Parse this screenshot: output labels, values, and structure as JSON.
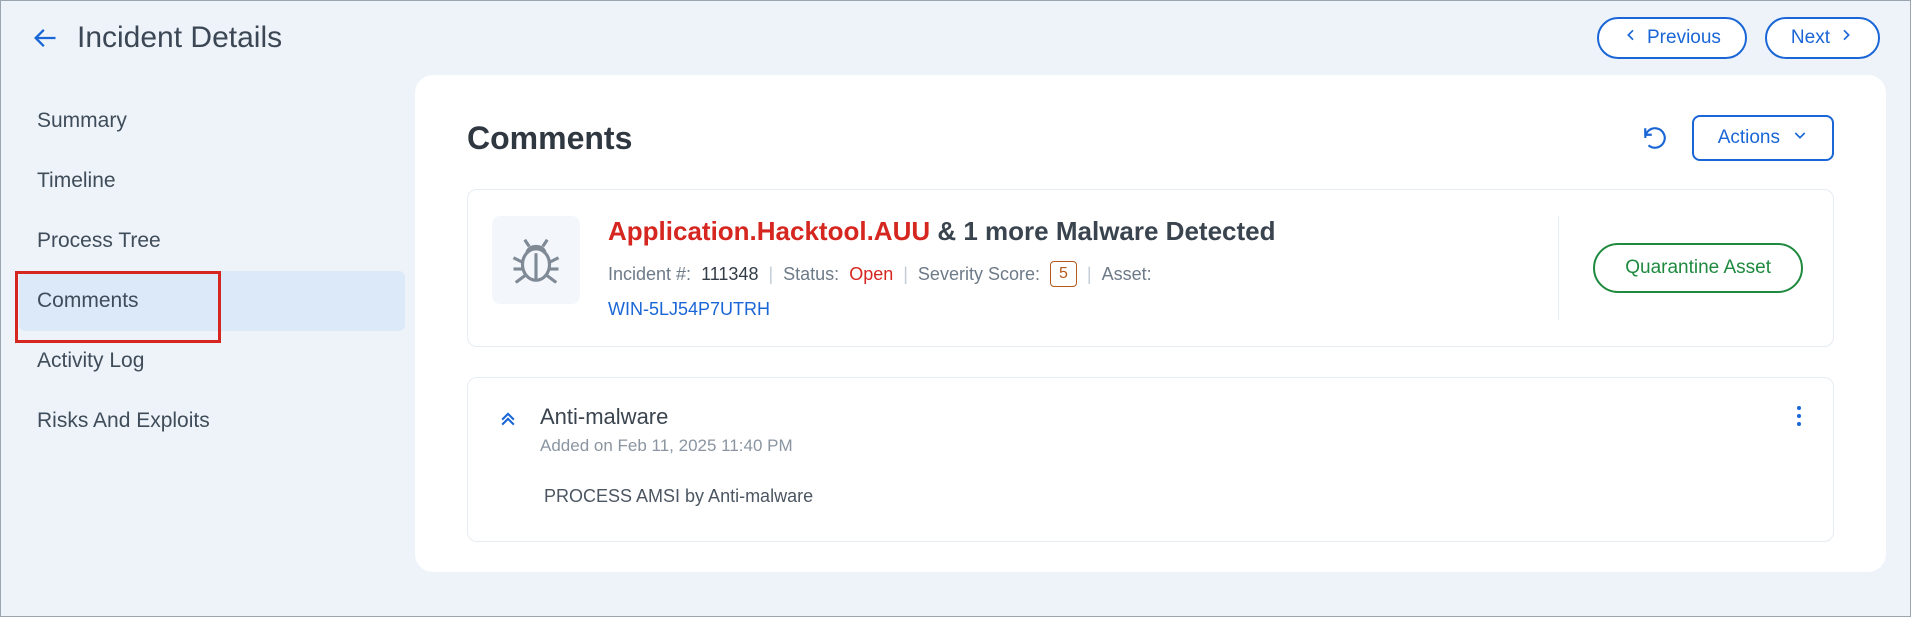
{
  "header": {
    "title": "Incident Details",
    "prev_label": "Previous",
    "next_label": "Next"
  },
  "sidebar": {
    "items": [
      {
        "label": "Summary",
        "active": false
      },
      {
        "label": "Timeline",
        "active": false
      },
      {
        "label": "Process Tree",
        "active": false
      },
      {
        "label": "Comments",
        "active": true
      },
      {
        "label": "Activity Log",
        "active": false
      },
      {
        "label": "Risks And Exploits",
        "active": false
      }
    ]
  },
  "main": {
    "title": "Comments",
    "actions_label": "Actions"
  },
  "incident": {
    "malware_name": "Application.Hacktool.AUU",
    "heading_suffix": " & 1 more Malware Detected",
    "incident_label": "Incident #:",
    "incident_value": "111348",
    "status_label": "Status:",
    "status_value": "Open",
    "severity_label": "Severity Score:",
    "severity_value": "5",
    "asset_label": "Asset:",
    "asset_value": "WIN-5LJ54P7UTRH",
    "quarantine_label": "Quarantine Asset"
  },
  "comment": {
    "title": "Anti-malware",
    "subtitle": "Added on Feb 11, 2025 11:40 PM",
    "body": "PROCESS AMSI by Anti-malware"
  }
}
